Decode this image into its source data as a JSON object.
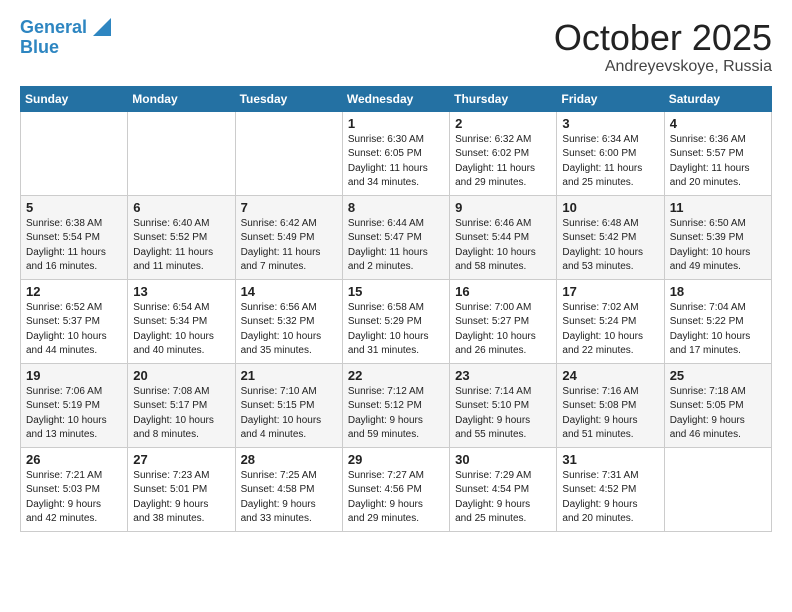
{
  "logo": {
    "line1": "General",
    "line2": "Blue"
  },
  "title": "October 2025",
  "location": "Andreyevskoye, Russia",
  "days_of_week": [
    "Sunday",
    "Monday",
    "Tuesday",
    "Wednesday",
    "Thursday",
    "Friday",
    "Saturday"
  ],
  "weeks": [
    [
      {
        "day": "",
        "info": ""
      },
      {
        "day": "",
        "info": ""
      },
      {
        "day": "",
        "info": ""
      },
      {
        "day": "1",
        "info": "Sunrise: 6:30 AM\nSunset: 6:05 PM\nDaylight: 11 hours\nand 34 minutes."
      },
      {
        "day": "2",
        "info": "Sunrise: 6:32 AM\nSunset: 6:02 PM\nDaylight: 11 hours\nand 29 minutes."
      },
      {
        "day": "3",
        "info": "Sunrise: 6:34 AM\nSunset: 6:00 PM\nDaylight: 11 hours\nand 25 minutes."
      },
      {
        "day": "4",
        "info": "Sunrise: 6:36 AM\nSunset: 5:57 PM\nDaylight: 11 hours\nand 20 minutes."
      }
    ],
    [
      {
        "day": "5",
        "info": "Sunrise: 6:38 AM\nSunset: 5:54 PM\nDaylight: 11 hours\nand 16 minutes."
      },
      {
        "day": "6",
        "info": "Sunrise: 6:40 AM\nSunset: 5:52 PM\nDaylight: 11 hours\nand 11 minutes."
      },
      {
        "day": "7",
        "info": "Sunrise: 6:42 AM\nSunset: 5:49 PM\nDaylight: 11 hours\nand 7 minutes."
      },
      {
        "day": "8",
        "info": "Sunrise: 6:44 AM\nSunset: 5:47 PM\nDaylight: 11 hours\nand 2 minutes."
      },
      {
        "day": "9",
        "info": "Sunrise: 6:46 AM\nSunset: 5:44 PM\nDaylight: 10 hours\nand 58 minutes."
      },
      {
        "day": "10",
        "info": "Sunrise: 6:48 AM\nSunset: 5:42 PM\nDaylight: 10 hours\nand 53 minutes."
      },
      {
        "day": "11",
        "info": "Sunrise: 6:50 AM\nSunset: 5:39 PM\nDaylight: 10 hours\nand 49 minutes."
      }
    ],
    [
      {
        "day": "12",
        "info": "Sunrise: 6:52 AM\nSunset: 5:37 PM\nDaylight: 10 hours\nand 44 minutes."
      },
      {
        "day": "13",
        "info": "Sunrise: 6:54 AM\nSunset: 5:34 PM\nDaylight: 10 hours\nand 40 minutes."
      },
      {
        "day": "14",
        "info": "Sunrise: 6:56 AM\nSunset: 5:32 PM\nDaylight: 10 hours\nand 35 minutes."
      },
      {
        "day": "15",
        "info": "Sunrise: 6:58 AM\nSunset: 5:29 PM\nDaylight: 10 hours\nand 31 minutes."
      },
      {
        "day": "16",
        "info": "Sunrise: 7:00 AM\nSunset: 5:27 PM\nDaylight: 10 hours\nand 26 minutes."
      },
      {
        "day": "17",
        "info": "Sunrise: 7:02 AM\nSunset: 5:24 PM\nDaylight: 10 hours\nand 22 minutes."
      },
      {
        "day": "18",
        "info": "Sunrise: 7:04 AM\nSunset: 5:22 PM\nDaylight: 10 hours\nand 17 minutes."
      }
    ],
    [
      {
        "day": "19",
        "info": "Sunrise: 7:06 AM\nSunset: 5:19 PM\nDaylight: 10 hours\nand 13 minutes."
      },
      {
        "day": "20",
        "info": "Sunrise: 7:08 AM\nSunset: 5:17 PM\nDaylight: 10 hours\nand 8 minutes."
      },
      {
        "day": "21",
        "info": "Sunrise: 7:10 AM\nSunset: 5:15 PM\nDaylight: 10 hours\nand 4 minutes."
      },
      {
        "day": "22",
        "info": "Sunrise: 7:12 AM\nSunset: 5:12 PM\nDaylight: 9 hours\nand 59 minutes."
      },
      {
        "day": "23",
        "info": "Sunrise: 7:14 AM\nSunset: 5:10 PM\nDaylight: 9 hours\nand 55 minutes."
      },
      {
        "day": "24",
        "info": "Sunrise: 7:16 AM\nSunset: 5:08 PM\nDaylight: 9 hours\nand 51 minutes."
      },
      {
        "day": "25",
        "info": "Sunrise: 7:18 AM\nSunset: 5:05 PM\nDaylight: 9 hours\nand 46 minutes."
      }
    ],
    [
      {
        "day": "26",
        "info": "Sunrise: 7:21 AM\nSunset: 5:03 PM\nDaylight: 9 hours\nand 42 minutes."
      },
      {
        "day": "27",
        "info": "Sunrise: 7:23 AM\nSunset: 5:01 PM\nDaylight: 9 hours\nand 38 minutes."
      },
      {
        "day": "28",
        "info": "Sunrise: 7:25 AM\nSunset: 4:58 PM\nDaylight: 9 hours\nand 33 minutes."
      },
      {
        "day": "29",
        "info": "Sunrise: 7:27 AM\nSunset: 4:56 PM\nDaylight: 9 hours\nand 29 minutes."
      },
      {
        "day": "30",
        "info": "Sunrise: 7:29 AM\nSunset: 4:54 PM\nDaylight: 9 hours\nand 25 minutes."
      },
      {
        "day": "31",
        "info": "Sunrise: 7:31 AM\nSunset: 4:52 PM\nDaylight: 9 hours\nand 20 minutes."
      },
      {
        "day": "",
        "info": ""
      }
    ]
  ]
}
